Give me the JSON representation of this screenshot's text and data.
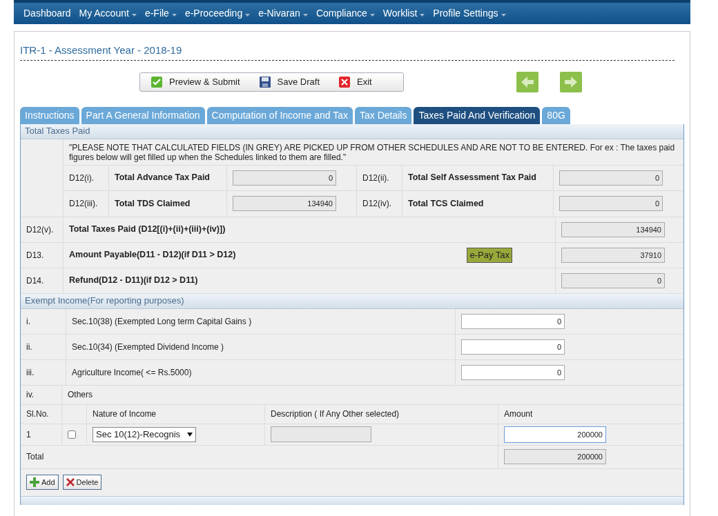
{
  "nav": [
    {
      "label": "Dashboard",
      "dropdown": false
    },
    {
      "label": "My Account",
      "dropdown": true
    },
    {
      "label": "e-File",
      "dropdown": true
    },
    {
      "label": "e-Proceeding",
      "dropdown": true
    },
    {
      "label": "e-Nivaran",
      "dropdown": true
    },
    {
      "label": "Compliance",
      "dropdown": true
    },
    {
      "label": "Worklist",
      "dropdown": true
    },
    {
      "label": "Profile Settings",
      "dropdown": true
    }
  ],
  "form_title": "ITR-1 - Assessment Year - 2018-19",
  "toolbar": [
    {
      "label": "Preview & Submit",
      "kind": "check"
    },
    {
      "label": "Save Draft",
      "kind": "save"
    },
    {
      "label": "Exit",
      "kind": "exit"
    }
  ],
  "tabs": [
    {
      "label": "Instructions",
      "selected": false
    },
    {
      "label": "Part A General Information",
      "selected": false
    },
    {
      "label": "Computation of Income and Tax",
      "selected": false
    },
    {
      "label": "Tax Details",
      "selected": false
    },
    {
      "label": "Taxes Paid And Verification",
      "selected": true
    },
    {
      "label": "80G",
      "selected": false
    }
  ],
  "taxes_paid": {
    "title": "Total Taxes Paid",
    "note": "\"PLEASE NOTE THAT CALCULATED FIELDS (IN GREY) ARE PICKED UP FROM OTHER SCHEDULES AND ARE NOT TO BE ENTERED. For ex : The taxes paid figures below will get filled up when the Schedules linked to them are filled.\"",
    "sub_rows": [
      [
        {
          "code": "D12(i).",
          "label": "Total Advance Tax Paid",
          "value": "0"
        },
        {
          "code": "D12(ii).",
          "label": "Total Self Assessment Tax Paid",
          "value": "0"
        }
      ],
      [
        {
          "code": "D12(iii).",
          "label": "Total TDS Claimed",
          "value": "134940"
        },
        {
          "code": "D12(iv).",
          "label": "Total TCS Claimed",
          "value": "0"
        }
      ]
    ],
    "rows": [
      {
        "code": "D12(v).",
        "label": "Total Taxes Paid (D12[(i)+(ii)+(iii)+(iv)])",
        "value": "134940"
      },
      {
        "code": "D13.",
        "label": "Amount Payable(D11 - D12)(if D11 > D12)",
        "value": "37910",
        "action": "e-Pay Tax"
      },
      {
        "code": "D14.",
        "label": "Refund(D12 - D11)(if D12 > D11)",
        "value": "0"
      }
    ]
  },
  "exempt": {
    "title": "Exempt Income(For reporting purposes)",
    "items": [
      {
        "code": "i.",
        "label": "Sec.10(38) (Exempted Long term Capital Gains )",
        "value": "0"
      },
      {
        "code": "ii.",
        "label": "Sec.10(34) (Exempted Dividend Income )",
        "value": "0"
      },
      {
        "code": "iii.",
        "label": "Agriculture Income( <= Rs.5000)",
        "value": "0"
      }
    ],
    "others": {
      "code": "iv.",
      "label": "Others"
    },
    "columns": [
      "Sl.No.",
      "Nature of Income",
      "Description ( If Any Other selected)",
      "Amount"
    ],
    "rows": [
      {
        "sl": "1",
        "checked": false,
        "nature": "Sec 10(12)-Recognis",
        "amount": "200000"
      }
    ],
    "total": {
      "label": "Total",
      "value": "200000"
    },
    "buttons": [
      {
        "label": "Add",
        "kind": "add"
      },
      {
        "label": "Delete",
        "kind": "delete"
      }
    ]
  }
}
